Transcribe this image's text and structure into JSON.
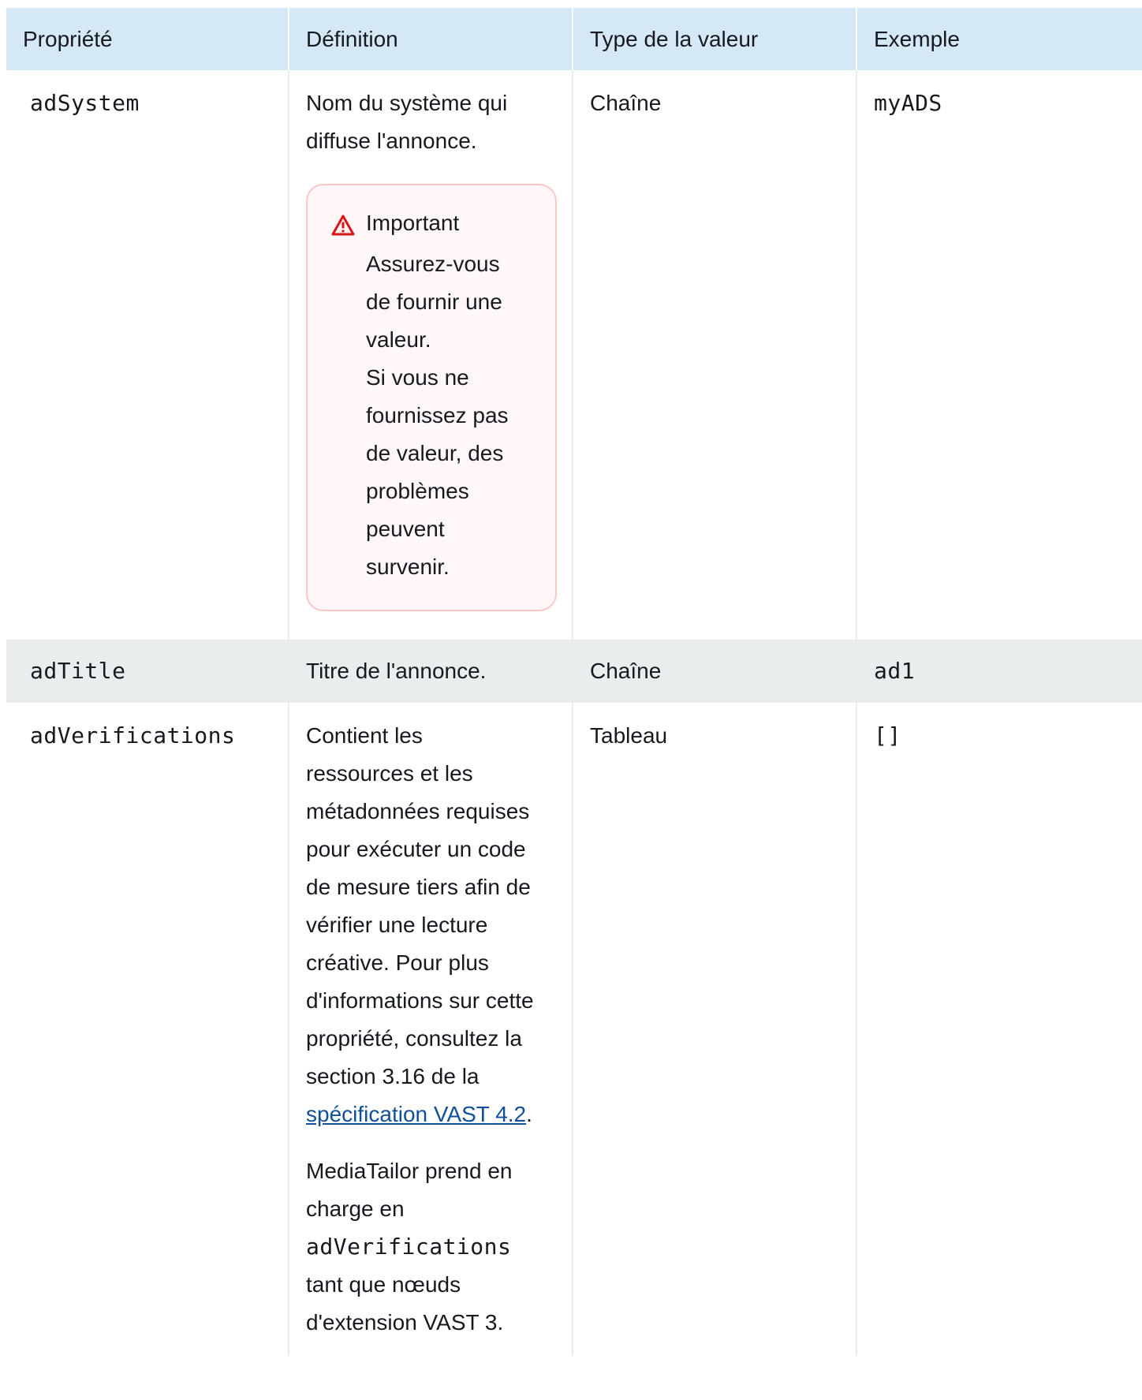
{
  "table": {
    "headers": [
      "Propriété",
      "Définition",
      "Type de la valeur",
      "Exemple"
    ],
    "rows": [
      {
        "property": "adSystem",
        "definition": "Nom du système qui diffuse l'annonce.",
        "alert_title": "Important",
        "alert_text_1": "Assurez-vous de fournir une valeur.",
        "alert_text_2": "Si vous ne fournissez pas de valeur, des problèmes peuvent survenir.",
        "type": "Chaîne",
        "example": "myADS"
      },
      {
        "property": "adTitle",
        "definition": "Titre de l'annonce.",
        "type": "Chaîne",
        "example": "ad1"
      },
      {
        "property": "adVerifications",
        "definition_p1_before": "Contient les ressources et les métadonnées requises pour exécuter un code de mesure tiers afin de vérifier une lecture créative. Pour plus d'informations sur cette propriété, consultez la section 3.16 de la ",
        "definition_p1_link": "spécification VAST 4.2",
        "definition_p1_after": ".",
        "definition_p2_before": "MediaTailor prend en charge en ",
        "definition_p2_code": "adVerifications",
        "definition_p2_after": " tant que nœuds d'extension VAST 3.",
        "type": "Tableau",
        "example": "[]"
      }
    ]
  },
  "colors": {
    "header_bg": "#d5e8f6",
    "alt_row_bg": "#eaeded",
    "alert_border": "#f8c8c4",
    "alert_icon": "#d91515",
    "link": "#0f4f9c"
  },
  "icons": {
    "alert": "warning-triangle-icon"
  }
}
